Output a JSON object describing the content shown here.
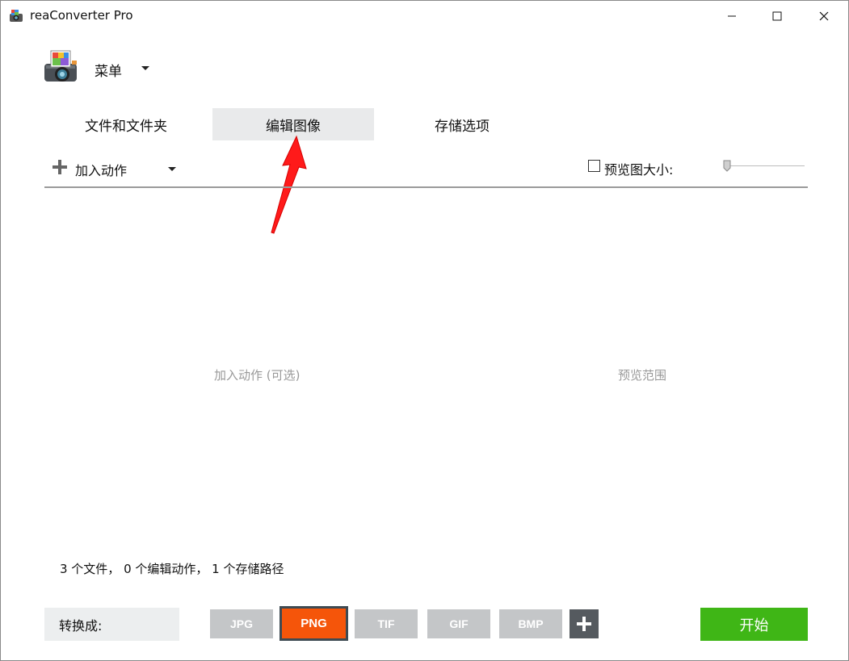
{
  "window": {
    "title": "reaConverter Pro",
    "icons": {
      "app": "camera-app-icon",
      "minimize": "minimize-icon",
      "maximize": "maximize-icon",
      "close": "close-icon"
    }
  },
  "menu": {
    "label": "菜单",
    "icon": "camera-logo-icon"
  },
  "tabs": [
    {
      "label": "文件和文件夹",
      "active": false
    },
    {
      "label": "编辑图像",
      "active": true
    },
    {
      "label": "存储选项",
      "active": false
    }
  ],
  "actions": {
    "add_label": "加入动作",
    "preview_size_label": "预览图大小:",
    "preview_checked": false
  },
  "placeholders": {
    "actions": "加入动作 (可选)",
    "preview": "预览范围"
  },
  "status": "3 个文件， 0 个编辑动作， 1 个存储路径",
  "convert": {
    "label": "转换成:",
    "formats": [
      "JPG",
      "PNG",
      "TIF",
      "GIF",
      "BMP"
    ],
    "selected": "PNG",
    "start_label": "开始"
  },
  "colors": {
    "selected_format": "#f5550a",
    "start_button": "#3fb616",
    "annotation_arrow": "#ff1a1a"
  }
}
